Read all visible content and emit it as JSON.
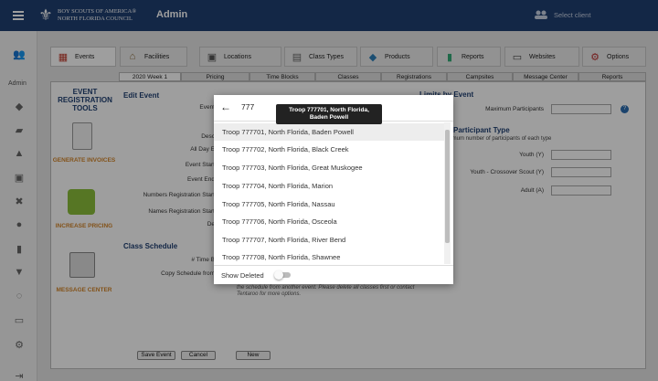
{
  "topbar": {
    "logo_line1": "BOY SCOUTS OF AMERICA®",
    "logo_line2": "NORTH FLORIDA COUNCIL",
    "title": "Admin",
    "select_client": "Select client"
  },
  "sidebar": {
    "admin_label": "Admin"
  },
  "nav_tabs": [
    {
      "label": "Events",
      "icon": "calendar-icon"
    },
    {
      "label": "Facilities",
      "icon": "house-icon"
    },
    {
      "label": "Locations",
      "icon": "map-pin-icon"
    },
    {
      "label": "Class Types",
      "icon": "book-icon"
    },
    {
      "label": "Products",
      "icon": "tag-icon"
    },
    {
      "label": "Reports",
      "icon": "bar-chart-icon"
    },
    {
      "label": "Websites",
      "icon": "monitor-icon"
    },
    {
      "label": "Options",
      "icon": "gears-icon"
    }
  ],
  "sub_tabs": [
    "2020 Week 1",
    "Pricing",
    "Time Blocks",
    "Classes",
    "Registrations",
    "Campsites",
    "Message Center",
    "Reports"
  ],
  "tools": {
    "title": "EVENT REGISTRATION TOOLS",
    "items": [
      "GENERATE INVOICES",
      "INCREASE PRICING",
      "MESSAGE CENTER"
    ]
  },
  "edit_event": {
    "header": "Edit Event",
    "labels": [
      "Event",
      "Desc",
      "All Day E",
      "Event Start",
      "Event End",
      "Numbers Registration Start",
      "Names Registration Start",
      "De"
    ],
    "class_schedule_header": "Class Schedule",
    "time_label": "# Time B",
    "copy_label": "Copy Schedule from",
    "note": "the schedule from another event. Please delete all classes first or contact Tentaroo for more options."
  },
  "limits": {
    "header": "Limits by Event",
    "max_label": "Maximum Participants",
    "type_header": "Participant Type",
    "type_sub": "Maximum number of participants of each type",
    "rows": [
      "Youth (Y)",
      "Youth - Crossover Scout (Y)",
      "Adult (A)"
    ]
  },
  "buttons": {
    "save": "Save Event",
    "cancel": "Cancel",
    "new": "New"
  },
  "dialog": {
    "search_value": "777",
    "tooltip": "Troop 777701, North Florida, Baden Powell",
    "options": [
      "Troop 777701, North Florida, Baden Powell",
      "Troop 777702, North Florida, Black Creek",
      "Troop 777703, North Florida, Great Muskogee",
      "Troop 777704, North Florida, Marion",
      "Troop 777705, North Florida, Nassau",
      "Troop 777706, North Florida, Osceola",
      "Troop 777707, North Florida, River Bend",
      "Troop 777708, North Florida, Shawnee"
    ],
    "show_deleted_label": "Show Deleted",
    "show_deleted_on": false
  }
}
